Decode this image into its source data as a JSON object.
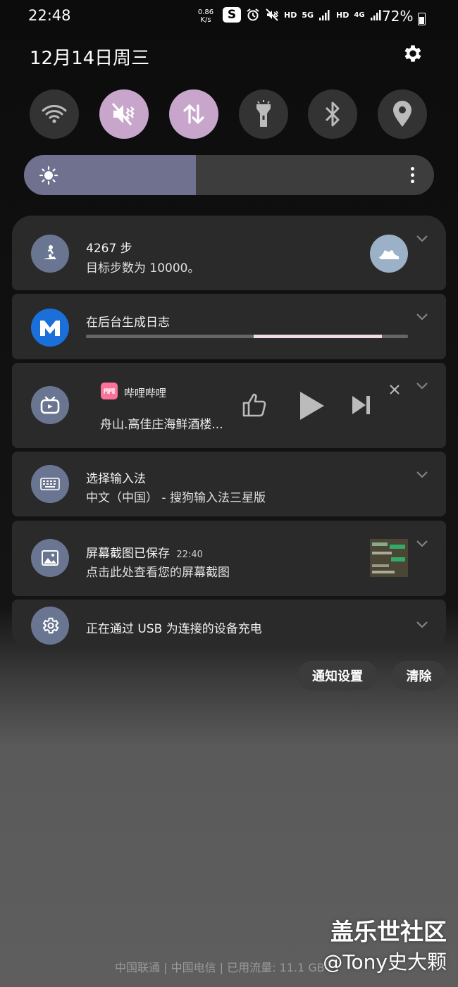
{
  "status_bar": {
    "time": "22:48",
    "net_speed_value": "0.86",
    "net_speed_unit": "K/s",
    "hd1": "HD",
    "five_g": "5G",
    "hd2": "HD",
    "four_g": "4G",
    "battery_percent": "72%",
    "battery_level": 0.72
  },
  "header": {
    "date": "12月14日周三"
  },
  "quick_toggles": [
    {
      "name": "wifi",
      "icon": "wifi-icon",
      "active": false
    },
    {
      "name": "sound",
      "icon": "mute-vibrate-icon",
      "active": true
    },
    {
      "name": "mobile-data",
      "icon": "data-arrows-icon",
      "active": true
    },
    {
      "name": "flashlight",
      "icon": "flashlight-icon",
      "active": false
    },
    {
      "name": "bluetooth",
      "icon": "bluetooth-icon",
      "active": false
    },
    {
      "name": "location",
      "icon": "location-pin-icon",
      "active": false
    }
  ],
  "brightness": {
    "level": 0.42
  },
  "notifications": {
    "steps": {
      "title": "4267 步",
      "subtitle": "目标步数为 10000。"
    },
    "log": {
      "title": "在后台生成日志",
      "progress": 0.92,
      "buffer_start": 0.52
    },
    "media": {
      "app_name": "哔哩哔哩",
      "track": "舟山.高佳庄海鲜酒楼..."
    },
    "ime": {
      "title": "选择输入法",
      "subtitle": "中文（中国） - 搜狗输入法三星版"
    },
    "screenshot": {
      "title": "屏幕截图已保存",
      "time": "22:40",
      "subtitle": "点击此处查看您的屏幕截图"
    },
    "usb": {
      "title": "正在通过 USB 为连接的设备充电"
    }
  },
  "actions": {
    "settings_label": "通知设置",
    "clear_label": "清除"
  },
  "footer": {
    "carrier": "中国联通 | 中国电信 | 已用流量: 11.1 GB"
  },
  "watermark": {
    "line1": "盖乐世社区",
    "line2": "@Tony史大颗"
  },
  "colors": {
    "toggle_active": "#c8a6cc",
    "brightness_fill": "#70708f",
    "icon_circle": "#6a7591",
    "bili_pink": "#fb7299",
    "m_blue": "#1a73e8"
  }
}
